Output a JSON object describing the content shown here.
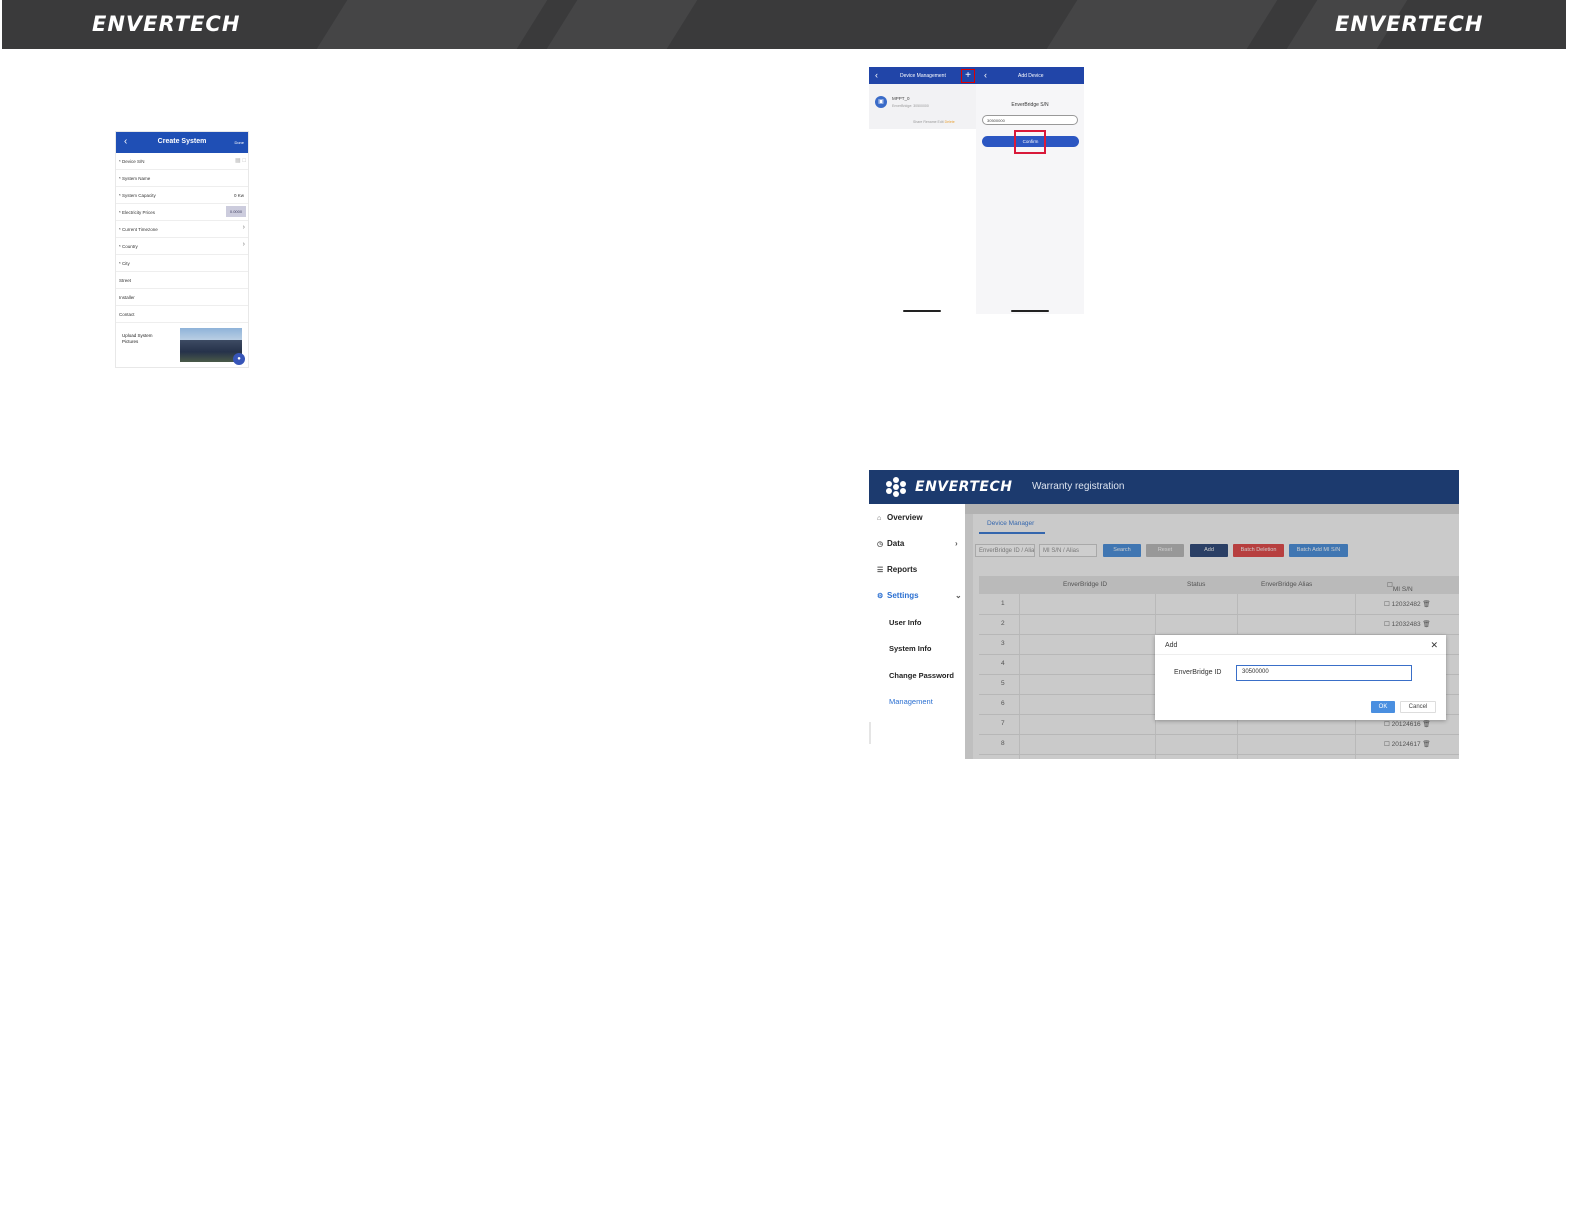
{
  "header": {
    "logo_left": "ENVERTECH",
    "logo_right": "ENVERTECH"
  },
  "create_system": {
    "title": "Create System",
    "done": "Done",
    "fields": [
      {
        "label": "* Device S/N"
      },
      {
        "label": "* System Name"
      },
      {
        "label": "* System Capacity",
        "value": "0 Kw"
      },
      {
        "label": "* Electricity Prices",
        "value": "0.0000"
      },
      {
        "label": "* Current Timezone"
      },
      {
        "label": "* Country"
      },
      {
        "label": "* City"
      },
      {
        "label": "Street"
      },
      {
        "label": "Installer"
      },
      {
        "label": "Contact"
      }
    ],
    "upload_label": "Upload System Pictures"
  },
  "device_management": {
    "title_left": "Device Management",
    "title_right": "Add Device",
    "plus": "+",
    "device_name": "MPPT_0",
    "device_sub": "EnverBridge: 30500000",
    "device_actions": [
      "Share",
      "Rename",
      "Edit",
      "Delete"
    ],
    "sn_label": "EnverBridge S/N",
    "sn_value": "30500000",
    "confirm": "Confirm"
  },
  "web": {
    "brand": "ENVERTECH",
    "page_title": "Warranty registration",
    "nav": [
      {
        "label": "Overview",
        "icon": "home-icon"
      },
      {
        "label": "Data",
        "icon": "clock-icon"
      },
      {
        "label": "Reports",
        "icon": "layers-icon"
      },
      {
        "label": "Settings",
        "icon": "gear-icon"
      }
    ],
    "sub_nav": [
      "User Info",
      "System Info",
      "Change Password",
      "Management"
    ],
    "tab": "Device Manager",
    "filter_id": "EnverBridge ID / Alias",
    "filter_msn": "MI S/N / Alias",
    "buttons": {
      "search": "Search",
      "reset": "Reset",
      "add": "Add",
      "batch_delete": "Batch Deletion",
      "batch_add": "Batch Add MI S/N"
    },
    "columns": [
      "EnverBridge ID",
      "Status",
      "EnverBridge Alias",
      "MI S/N"
    ],
    "rows": [
      {
        "num": "1",
        "msn": "12032482"
      },
      {
        "num": "2",
        "msn": "12032483"
      },
      {
        "num": "3",
        "msn": ""
      },
      {
        "num": "4",
        "msn": ""
      },
      {
        "num": "5",
        "msn": ""
      },
      {
        "num": "6",
        "msn": ""
      },
      {
        "num": "7",
        "msn": "20124616"
      },
      {
        "num": "8",
        "msn": "20124617"
      }
    ],
    "dialog": {
      "title": "Add",
      "label": "EnverBridge ID",
      "value": "30500000",
      "ok": "OK",
      "cancel": "Cancel"
    }
  },
  "colors": {
    "header_bg": "#3a3a3b",
    "app_blue": "#1f4fb5",
    "web_header": "#1c3a6e",
    "highlight_red": "#d8193a",
    "batch_delete_red": "#e03a3a"
  }
}
